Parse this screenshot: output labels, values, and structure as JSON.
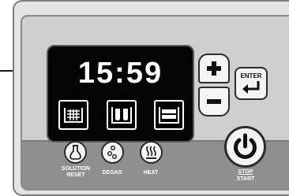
{
  "display": {
    "time": "15:59",
    "modes": [
      {
        "icon": "solution-bath-icon"
      },
      {
        "icon": "degas-bath-icon"
      },
      {
        "icon": "heat-bath-icon"
      }
    ]
  },
  "controls": {
    "plus_icon": "plus-icon",
    "minus_icon": "minus-icon",
    "enter_label": "ENTER",
    "enter_icon": "enter-arrow-icon"
  },
  "buttons": {
    "solution_reset": {
      "label_line1": "SOLUTION",
      "label_line2": "RESET",
      "icon": "flask-icon"
    },
    "degas": {
      "label": "DEGAS",
      "icon": "bubbles-icon"
    },
    "heat": {
      "label": "HEAT",
      "icon": "heat-waves-icon"
    },
    "stop_start": {
      "label_top": "STOP",
      "label_bottom": "START",
      "icon": "power-icon"
    }
  },
  "colors": {
    "display_bg": "#040404",
    "display_text": "#ffffff",
    "panel": "#cfcfcf",
    "band": "#8f8f8f"
  }
}
